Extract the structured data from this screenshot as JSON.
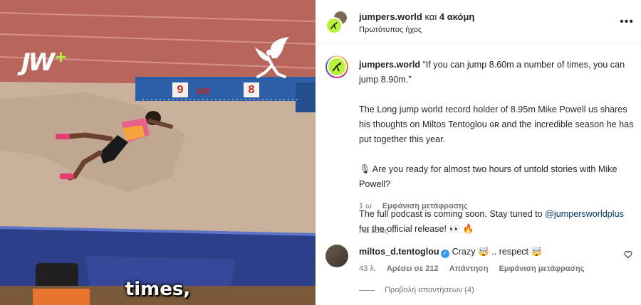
{
  "media": {
    "brand_logo": "JW",
    "brand_plus": "+",
    "board_left": "9",
    "board_nr": "NR",
    "board_right": "8",
    "subtitle": "times,"
  },
  "header": {
    "username": "jumpers.world",
    "and_text": "και",
    "others": "4 ακόμη",
    "audio": "Πρωτότυπος ήχος",
    "more": "•••"
  },
  "caption": {
    "username": "jumpers.world",
    "quote": "“If you can jump 8.60m a number of times, you can jump 8.90m.”",
    "para2": "The Long jump world record holder of 8.95m Mike Powell us shares his thoughts on Miltos Tentoglou ɢʀ and the incredible season he has put together this year.",
    "para3": "🎙 Are you ready for almost two hours of untold stories with Mike Powell?",
    "para4_prefix": "The full podcast is coming soon. Stay tuned to",
    "mention": "@jumpersworldplus",
    "para4_suffix": "for the official release! 👀 🔥",
    "time": "1 ω",
    "translate": "Εμφάνιση μετάφρασης"
  },
  "for_you": "Για εσάς ⌵",
  "comment": {
    "username": "miltos_d.tentoglou",
    "text": "Crazy 🤯 .. respect 🤯",
    "time": "43 λ.",
    "likes": "Αρέσει σε 212",
    "reply": "Απάντηση",
    "translate": "Εμφάνιση μετάφρασης",
    "view_replies": "Προβολή απαντήσεων (4)"
  },
  "colors": {
    "accent_green": "#b6f23a",
    "link": "#00376b",
    "secondary_text": "#737373",
    "verified": "#3897f0"
  }
}
